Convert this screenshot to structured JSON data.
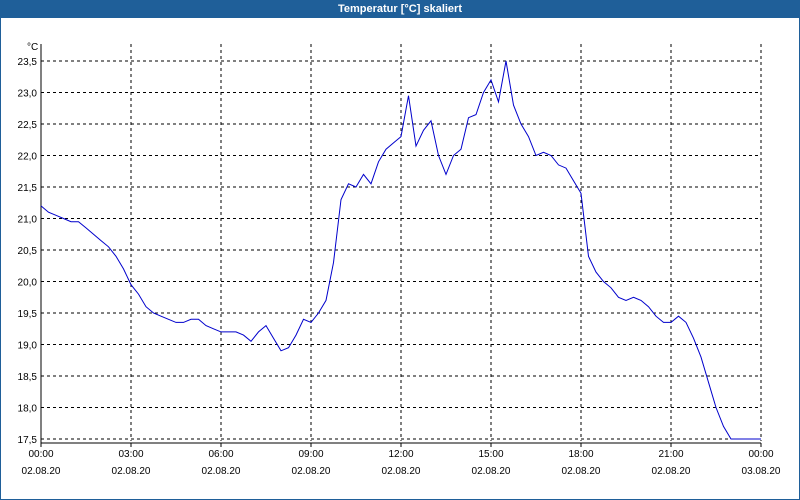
{
  "window": {
    "title": "Temperatur [°C] skaliert"
  },
  "chart_data": {
    "type": "line",
    "title": "Temperatur [°C] skaliert",
    "ylabel": "°C",
    "xlabel": "",
    "ylim": [
      17.5,
      23.5
    ],
    "xlim_hours": [
      0,
      24
    ],
    "grid": true,
    "y_ticks": [
      "17,5",
      "18,0",
      "18,5",
      "19,0",
      "19,5",
      "20,0",
      "20,5",
      "21,0",
      "21,5",
      "22,0",
      "22,5",
      "23,0",
      "23,5"
    ],
    "x_ticks": [
      {
        "time": "00:00",
        "date": "02.08.20"
      },
      {
        "time": "03:00",
        "date": "02.08.20"
      },
      {
        "time": "06:00",
        "date": "02.08.20"
      },
      {
        "time": "09:00",
        "date": "02.08.20"
      },
      {
        "time": "12:00",
        "date": "02.08.20"
      },
      {
        "time": "15:00",
        "date": "02.08.20"
      },
      {
        "time": "18:00",
        "date": "02.08.20"
      },
      {
        "time": "21:00",
        "date": "02.08.20"
      },
      {
        "time": "00:00",
        "date": "03.08.20"
      }
    ],
    "series": [
      {
        "color": "#0000cc",
        "x": [
          "02.08.20 00:00",
          "02.08.20 00:15",
          "02.08.20 00:30",
          "02.08.20 00:45",
          "02.08.20 01:00",
          "02.08.20 01:15",
          "02.08.20 01:30",
          "02.08.20 01:45",
          "02.08.20 02:00",
          "02.08.20 02:15",
          "02.08.20 02:30",
          "02.08.20 02:45",
          "02.08.20 03:00",
          "02.08.20 03:15",
          "02.08.20 03:30",
          "02.08.20 03:45",
          "02.08.20 04:00",
          "02.08.20 04:15",
          "02.08.20 04:30",
          "02.08.20 04:45",
          "02.08.20 05:00",
          "02.08.20 05:15",
          "02.08.20 05:30",
          "02.08.20 05:45",
          "02.08.20 06:00",
          "02.08.20 06:15",
          "02.08.20 06:30",
          "02.08.20 06:45",
          "02.08.20 07:00",
          "02.08.20 07:15",
          "02.08.20 07:30",
          "02.08.20 07:45",
          "02.08.20 08:00",
          "02.08.20 08:15",
          "02.08.20 08:30",
          "02.08.20 08:45",
          "02.08.20 09:00",
          "02.08.20 09:15",
          "02.08.20 09:30",
          "02.08.20 09:45",
          "02.08.20 10:00",
          "02.08.20 10:15",
          "02.08.20 10:30",
          "02.08.20 10:45",
          "02.08.20 11:00",
          "02.08.20 11:15",
          "02.08.20 11:30",
          "02.08.20 11:45",
          "02.08.20 12:00",
          "02.08.20 12:15",
          "02.08.20 12:30",
          "02.08.20 12:45",
          "02.08.20 13:00",
          "02.08.20 13:15",
          "02.08.20 13:30",
          "02.08.20 13:45",
          "02.08.20 14:00",
          "02.08.20 14:15",
          "02.08.20 14:30",
          "02.08.20 14:45",
          "02.08.20 15:00",
          "02.08.20 15:15",
          "02.08.20 15:30",
          "02.08.20 15:45",
          "02.08.20 16:00",
          "02.08.20 16:15",
          "02.08.20 16:30",
          "02.08.20 16:45",
          "02.08.20 17:00",
          "02.08.20 17:15",
          "02.08.20 17:30",
          "02.08.20 17:45",
          "02.08.20 18:00",
          "02.08.20 18:15",
          "02.08.20 18:30",
          "02.08.20 18:45",
          "02.08.20 19:00",
          "02.08.20 19:15",
          "02.08.20 19:30",
          "02.08.20 19:45",
          "02.08.20 20:00",
          "02.08.20 20:15",
          "02.08.20 20:30",
          "02.08.20 20:45",
          "02.08.20 21:00",
          "02.08.20 21:15",
          "02.08.20 21:30",
          "02.08.20 21:45",
          "02.08.20 22:00",
          "02.08.20 22:15",
          "02.08.20 22:30",
          "02.08.20 22:45",
          "02.08.20 23:00",
          "02.08.20 23:15",
          "02.08.20 23:30",
          "02.08.20 23:45",
          "03.08.20 00:00"
        ],
        "y": [
          21.2,
          21.1,
          21.05,
          21.0,
          20.95,
          20.95,
          20.85,
          20.75,
          20.65,
          20.55,
          20.4,
          20.2,
          19.95,
          19.8,
          19.6,
          19.5,
          19.45,
          19.4,
          19.35,
          19.35,
          19.4,
          19.4,
          19.3,
          19.25,
          19.2,
          19.2,
          19.2,
          19.15,
          19.05,
          19.2,
          19.3,
          19.1,
          18.9,
          18.95,
          19.15,
          19.4,
          19.35,
          19.5,
          19.7,
          20.3,
          21.3,
          21.55,
          21.5,
          21.7,
          21.55,
          21.9,
          22.1,
          22.2,
          22.3,
          22.95,
          22.15,
          22.4,
          22.55,
          22.0,
          21.7,
          22.0,
          22.1,
          22.6,
          22.65,
          23.0,
          23.2,
          22.85,
          23.5,
          22.8,
          22.5,
          22.3,
          22.0,
          22.05,
          22.0,
          21.85,
          21.8,
          21.6,
          21.4,
          20.4,
          20.15,
          20.0,
          19.9,
          19.75,
          19.7,
          19.75,
          19.7,
          19.6,
          19.45,
          19.35,
          19.35,
          19.45,
          19.35,
          19.1,
          18.8,
          18.4,
          18.0,
          17.7,
          17.5,
          17.5,
          17.5,
          17.5,
          17.5
        ]
      }
    ]
  }
}
